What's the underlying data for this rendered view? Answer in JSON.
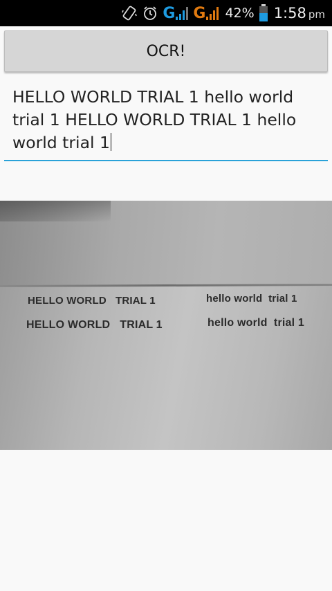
{
  "status_bar": {
    "network_1": "G",
    "network_2": "G",
    "battery_percent": "42%",
    "time": "1:58",
    "ampm": "pm",
    "icons": [
      "vibrate-icon",
      "alarm-icon",
      "signal-icon",
      "signal-icon",
      "battery-icon"
    ],
    "colors": {
      "network_1": "#1e9be0",
      "network_2": "#e07a10",
      "battery": "#1e9be0"
    }
  },
  "ocr_button": {
    "label": "OCR!"
  },
  "text_field": {
    "value": "HELLO WORLD TRIAL 1 hello world trial 1 HELLO WORLD TRIAL 1 hello world trial 1",
    "underline_color": "#2aa2d8"
  },
  "photo": {
    "lines": [
      "HELLO WORLD   TRIAL 1",
      "hello world  trial 1",
      "HELLO WORLD   TRIAL 1",
      "hello world  trial 1"
    ]
  }
}
